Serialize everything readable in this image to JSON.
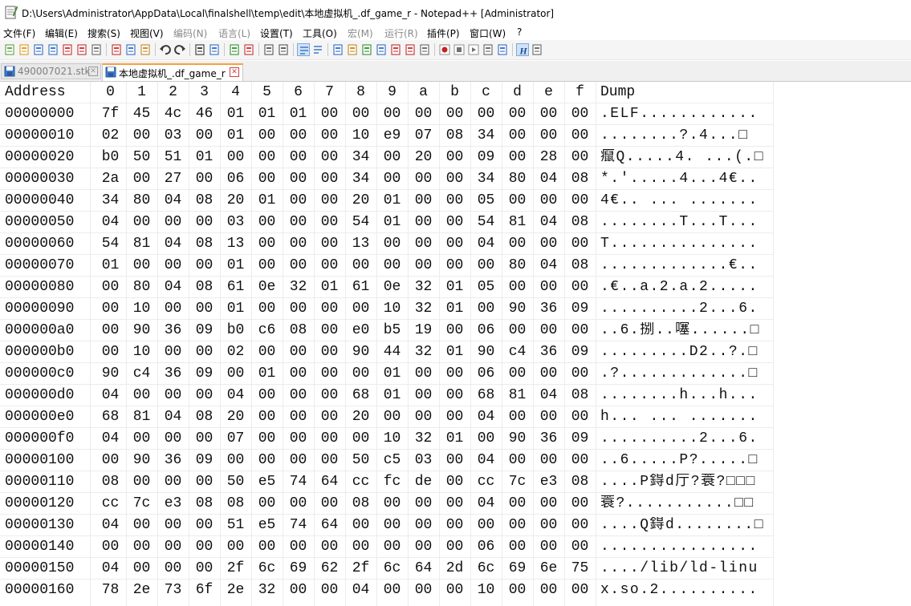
{
  "window": {
    "title": "D:\\Users\\Administrator\\AppData\\Local\\finalshell\\temp\\edit\\本地虚拟机_.df_game_r - Notepad++ [Administrator]"
  },
  "menu": [
    "文件(F)",
    "编辑(E)",
    "搜索(S)",
    "视图(V)",
    "编码(N)",
    "语言(L)",
    "设置(T)",
    "工具(O)",
    "宏(M)",
    "运行(R)",
    "插件(P)",
    "窗口(W)",
    "?"
  ],
  "toolbar_icons": [
    "new-file-icon",
    "open-file-icon",
    "save-icon",
    "save-all-icon",
    "close-icon",
    "close-all-icon",
    "print-icon",
    "cut-icon",
    "copy-icon",
    "paste-icon",
    "undo-icon",
    "redo-icon",
    "find-icon",
    "replace-icon",
    "zoom-in-icon",
    "zoom-out-icon",
    "sync-vertical-icon",
    "sync-horizontal-icon",
    "word-wrap-icon",
    "show-all-chars-icon",
    "indent-guide-icon",
    "language-udl-icon",
    "doc-map-icon",
    "function-list-icon",
    "folder-workspace-icon",
    "monitoring-icon",
    "eye-icon",
    "record-macro-icon",
    "stop-record-icon",
    "play-macro-icon",
    "run-macro-multiple-icon",
    "save-macro-icon",
    "hex-editor-icon"
  ],
  "tabs": [
    {
      "label": "490007021.stk",
      "active": false
    },
    {
      "label": "本地虚拟机_.df_game_r",
      "active": true
    }
  ],
  "hex": {
    "header": {
      "address": "Address",
      "columns": [
        "0",
        "1",
        "2",
        "3",
        "4",
        "5",
        "6",
        "7",
        "8",
        "9",
        "a",
        "b",
        "c",
        "d",
        "e",
        "f"
      ],
      "dump": "Dump"
    },
    "rows": [
      {
        "addr": "00000000",
        "bytes": [
          "7f",
          "45",
          "4c",
          "46",
          "01",
          "01",
          "01",
          "00",
          "00",
          "00",
          "00",
          "00",
          "00",
          "00",
          "00",
          "00"
        ],
        "dump": ".ELF............"
      },
      {
        "addr": "00000010",
        "bytes": [
          "02",
          "00",
          "03",
          "00",
          "01",
          "00",
          "00",
          "00",
          "10",
          "e9",
          "07",
          "08",
          "34",
          "00",
          "00",
          "00"
        ],
        "dump": "........?.4...□"
      },
      {
        "addr": "00000020",
        "bytes": [
          "b0",
          "50",
          "51",
          "01",
          "00",
          "00",
          "00",
          "00",
          "34",
          "00",
          "20",
          "00",
          "09",
          "00",
          "28",
          "00"
        ],
        "dump": "癙Q.....4. ...(.□"
      },
      {
        "addr": "00000030",
        "bytes": [
          "2a",
          "00",
          "27",
          "00",
          "06",
          "00",
          "00",
          "00",
          "34",
          "00",
          "00",
          "00",
          "34",
          "80",
          "04",
          "08"
        ],
        "dump": "*.'.....4...4€.."
      },
      {
        "addr": "00000040",
        "bytes": [
          "34",
          "80",
          "04",
          "08",
          "20",
          "01",
          "00",
          "00",
          "20",
          "01",
          "00",
          "00",
          "05",
          "00",
          "00",
          "00"
        ],
        "dump": "4€.. ... ......."
      },
      {
        "addr": "00000050",
        "bytes": [
          "04",
          "00",
          "00",
          "00",
          "03",
          "00",
          "00",
          "00",
          "54",
          "01",
          "00",
          "00",
          "54",
          "81",
          "04",
          "08"
        ],
        "dump": "........T...T..."
      },
      {
        "addr": "00000060",
        "bytes": [
          "54",
          "81",
          "04",
          "08",
          "13",
          "00",
          "00",
          "00",
          "13",
          "00",
          "00",
          "00",
          "04",
          "00",
          "00",
          "00"
        ],
        "dump": "T..............."
      },
      {
        "addr": "00000070",
        "bytes": [
          "01",
          "00",
          "00",
          "00",
          "01",
          "00",
          "00",
          "00",
          "00",
          "00",
          "00",
          "00",
          "00",
          "80",
          "04",
          "08"
        ],
        "dump": ".............€.."
      },
      {
        "addr": "00000080",
        "bytes": [
          "00",
          "80",
          "04",
          "08",
          "61",
          "0e",
          "32",
          "01",
          "61",
          "0e",
          "32",
          "01",
          "05",
          "00",
          "00",
          "00"
        ],
        "dump": ".€..a.2.a.2....."
      },
      {
        "addr": "00000090",
        "bytes": [
          "00",
          "10",
          "00",
          "00",
          "01",
          "00",
          "00",
          "00",
          "00",
          "10",
          "32",
          "01",
          "00",
          "90",
          "36",
          "09"
        ],
        "dump": "..........2...6."
      },
      {
        "addr": "000000a0",
        "bytes": [
          "00",
          "90",
          "36",
          "09",
          "b0",
          "c6",
          "08",
          "00",
          "e0",
          "b5",
          "19",
          "00",
          "06",
          "00",
          "00",
          "00"
        ],
        "dump": "..6.捌..噻......□"
      },
      {
        "addr": "000000b0",
        "bytes": [
          "00",
          "10",
          "00",
          "00",
          "02",
          "00",
          "00",
          "00",
          "90",
          "44",
          "32",
          "01",
          "90",
          "c4",
          "36",
          "09"
        ],
        "dump": ".........D2..?.□"
      },
      {
        "addr": "000000c0",
        "bytes": [
          "90",
          "c4",
          "36",
          "09",
          "00",
          "01",
          "00",
          "00",
          "00",
          "01",
          "00",
          "00",
          "06",
          "00",
          "00",
          "00"
        ],
        "dump": ".?.............□"
      },
      {
        "addr": "000000d0",
        "bytes": [
          "04",
          "00",
          "00",
          "00",
          "04",
          "00",
          "00",
          "00",
          "68",
          "01",
          "00",
          "00",
          "68",
          "81",
          "04",
          "08"
        ],
        "dump": "........h...h..."
      },
      {
        "addr": "000000e0",
        "bytes": [
          "68",
          "81",
          "04",
          "08",
          "20",
          "00",
          "00",
          "00",
          "20",
          "00",
          "00",
          "00",
          "04",
          "00",
          "00",
          "00"
        ],
        "dump": "h... ... ......."
      },
      {
        "addr": "000000f0",
        "bytes": [
          "04",
          "00",
          "00",
          "00",
          "07",
          "00",
          "00",
          "00",
          "00",
          "10",
          "32",
          "01",
          "00",
          "90",
          "36",
          "09"
        ],
        "dump": "..........2...6."
      },
      {
        "addr": "00000100",
        "bytes": [
          "00",
          "90",
          "36",
          "09",
          "00",
          "00",
          "00",
          "00",
          "50",
          "c5",
          "03",
          "00",
          "04",
          "00",
          "00",
          "00"
        ],
        "dump": "..6.....P?.....□"
      },
      {
        "addr": "00000110",
        "bytes": [
          "08",
          "00",
          "00",
          "00",
          "50",
          "e5",
          "74",
          "64",
          "cc",
          "fc",
          "de",
          "00",
          "cc",
          "7c",
          "e3",
          "08"
        ],
        "dump": "....P鍀d厅?蓑?□□□"
      },
      {
        "addr": "00000120",
        "bytes": [
          "cc",
          "7c",
          "e3",
          "08",
          "08",
          "00",
          "00",
          "00",
          "08",
          "00",
          "00",
          "00",
          "04",
          "00",
          "00",
          "00"
        ],
        "dump": "蓑?...........□□"
      },
      {
        "addr": "00000130",
        "bytes": [
          "04",
          "00",
          "00",
          "00",
          "51",
          "e5",
          "74",
          "64",
          "00",
          "00",
          "00",
          "00",
          "00",
          "00",
          "00",
          "00"
        ],
        "dump": "....Q鍀d........□"
      },
      {
        "addr": "00000140",
        "bytes": [
          "00",
          "00",
          "00",
          "00",
          "00",
          "00",
          "00",
          "00",
          "00",
          "00",
          "00",
          "00",
          "06",
          "00",
          "00",
          "00"
        ],
        "dump": "................"
      },
      {
        "addr": "00000150",
        "bytes": [
          "04",
          "00",
          "00",
          "00",
          "2f",
          "6c",
          "69",
          "62",
          "2f",
          "6c",
          "64",
          "2d",
          "6c",
          "69",
          "6e",
          "75"
        ],
        "dump": "..../lib/ld-linu"
      },
      {
        "addr": "00000160",
        "bytes": [
          "78",
          "2e",
          "73",
          "6f",
          "2e",
          "32",
          "00",
          "00",
          "04",
          "00",
          "00",
          "00",
          "10",
          "00",
          "00",
          "00"
        ],
        "dump": "x.so.2.........."
      }
    ]
  }
}
